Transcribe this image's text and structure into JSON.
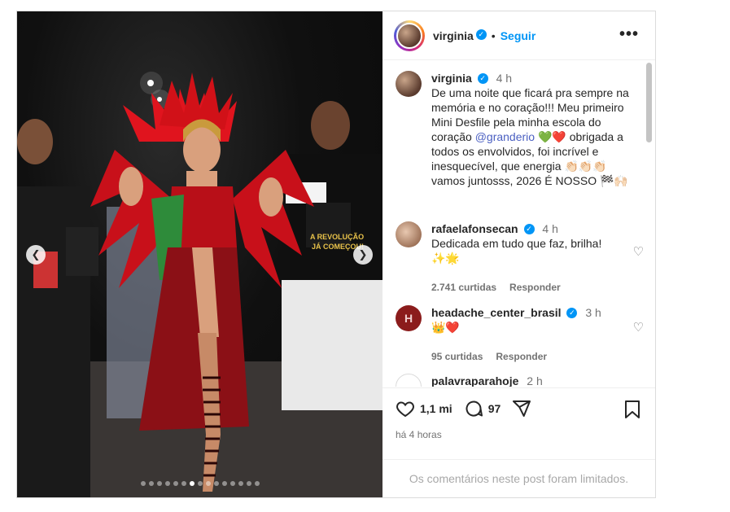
{
  "post": {
    "author": "virginia",
    "follow_label": "Seguir",
    "separator": "•",
    "more_label": "•••",
    "carousel": {
      "total_slides": 15,
      "active_index": 6
    }
  },
  "caption": {
    "username": "virginia",
    "time": "4 h",
    "text_before_mention": "De uma noite que ficará pra sempre na memória e no coração!!! Meu primeiro Mini Desfile pela minha escola do coração ",
    "mention": "@granderio",
    "text_after_mention": " 💚❤️ obrigada a todos os envolvidos, foi incrível e inesquecível, que energia 👏🏻👏🏻👏🏻 vamos juntosss, 2026 É NOSSO 🏁🙌🏻"
  },
  "comments": [
    {
      "username": "rafaelafonsecan",
      "time": "4 h",
      "text": "Dedicada em tudo que faz, brilha! ✨🌟",
      "likes": "2.741 curtidas",
      "reply": "Responder"
    },
    {
      "username": "headache_center_brasil",
      "time": "3 h",
      "text": "👑❤️",
      "likes": "95 curtidas",
      "reply": "Responder"
    },
    {
      "username": "palavraparahoje",
      "time": "2 h"
    }
  ],
  "actions": {
    "likes": "1,1 mi",
    "comments": "97",
    "posted": "há 4 horas"
  },
  "footer": {
    "limited_text": "Os comentários neste post foram limitados."
  }
}
